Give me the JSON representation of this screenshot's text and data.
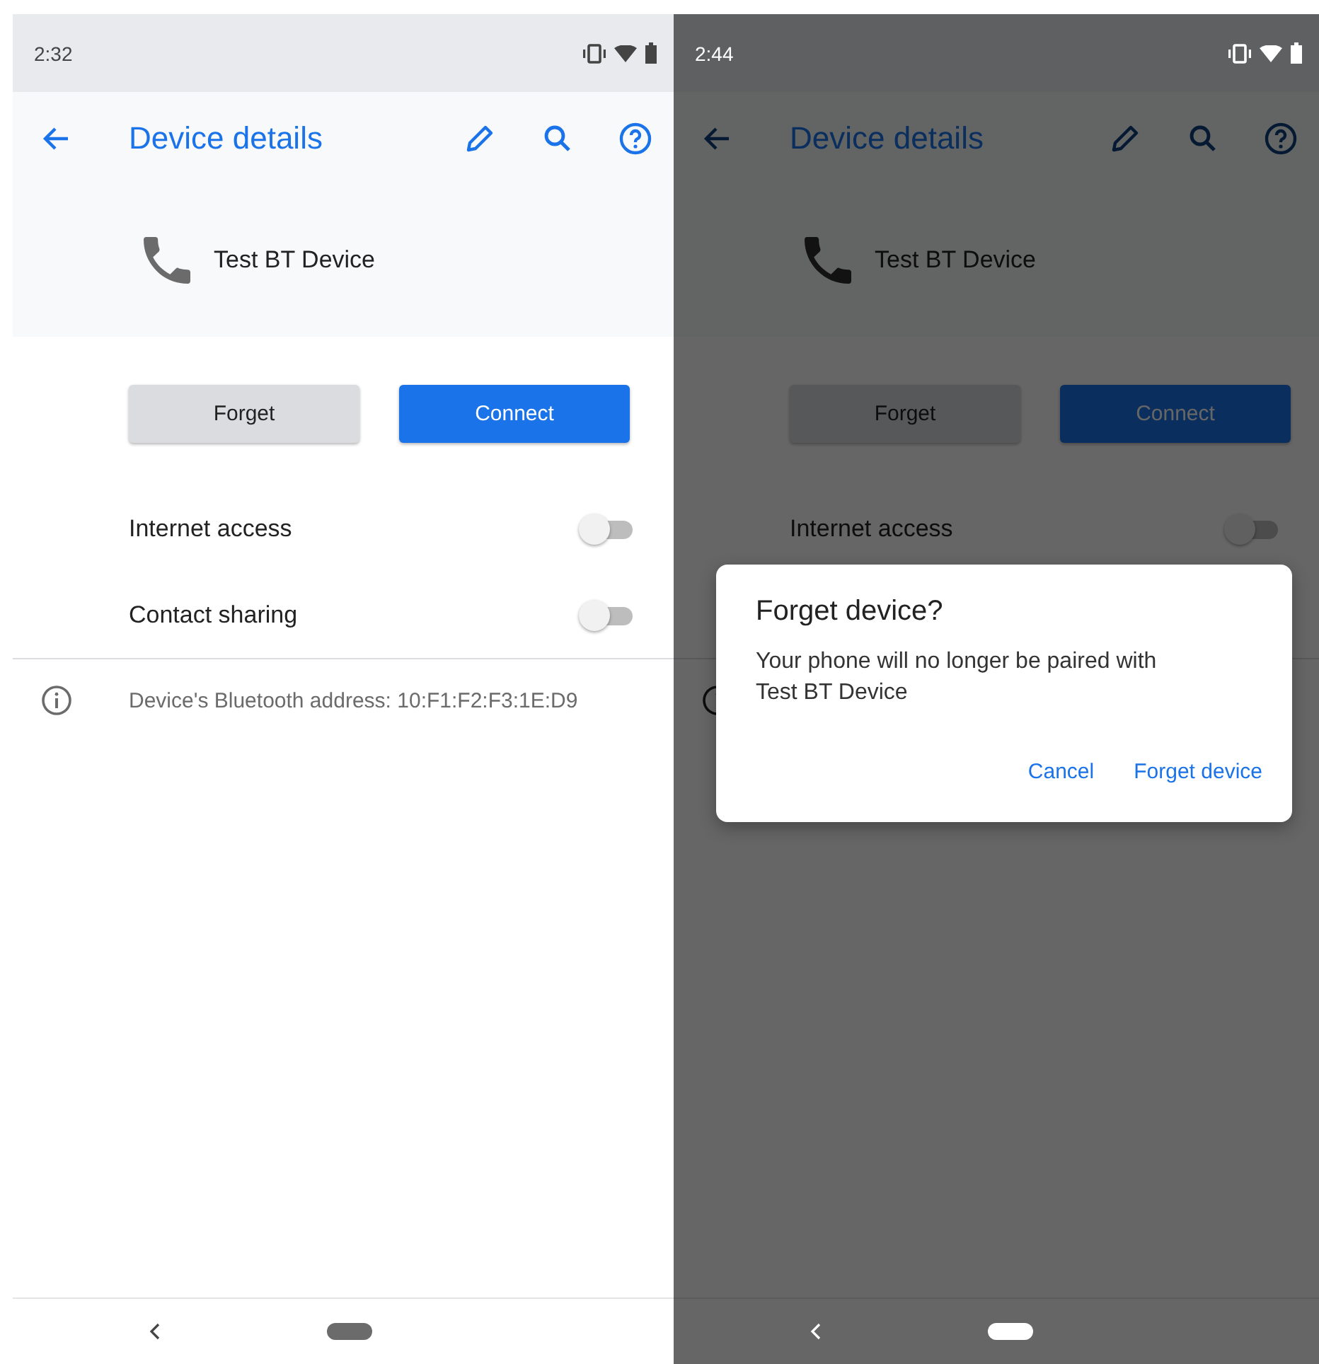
{
  "screens": [
    {
      "dimmed": false,
      "status_bar": {
        "time": "2:32"
      },
      "toolbar": {
        "title": "Device details"
      },
      "device": {
        "name": "Test BT Device"
      },
      "buttons": [
        {
          "label": "Forget",
          "kind": "secondary"
        },
        {
          "label": "Connect",
          "kind": "primary"
        }
      ],
      "toggles": [
        {
          "label": "Internet access",
          "on": false
        },
        {
          "label": "Contact sharing",
          "on": false
        }
      ],
      "info": {
        "text": "Device's Bluetooth address: 10:F1:F2:F3:1E:D9"
      }
    },
    {
      "dimmed": true,
      "status_bar": {
        "time": "2:44"
      },
      "toolbar": {
        "title": "Device details"
      },
      "device": {
        "name": "Test BT Device"
      },
      "buttons": [
        {
          "label": "Forget",
          "kind": "secondary"
        },
        {
          "label": "Connect",
          "kind": "primary"
        }
      ],
      "toggles": [
        {
          "label": "Internet access",
          "on": false
        }
      ],
      "dialog": {
        "title": "Forget device?",
        "message": "Your phone will no longer be paired with\nTest BT Device",
        "actions": [
          "Cancel",
          "Forget device"
        ]
      }
    }
  ]
}
